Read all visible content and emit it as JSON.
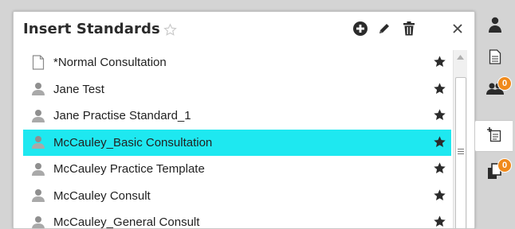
{
  "panel": {
    "title": "Insert Standards",
    "icons": {
      "favorite_title": "star-outline-icon",
      "add": "plus-circle-icon",
      "edit": "pencil-icon",
      "delete": "trash-icon",
      "close": "close-icon"
    }
  },
  "items": [
    {
      "label": "*Normal Consultation",
      "icon": "document-icon",
      "selected": false
    },
    {
      "label": "Jane Test",
      "icon": "user-icon",
      "selected": false
    },
    {
      "label": "Jane Practise Standard_1",
      "icon": "user-icon",
      "selected": false
    },
    {
      "label": "McCauley_Basic Consultation",
      "icon": "user-icon",
      "selected": true
    },
    {
      "label": "McCauley Practice Template",
      "icon": "user-icon",
      "selected": false
    },
    {
      "label": "McCauley Consult",
      "icon": "user-icon",
      "selected": false
    },
    {
      "label": "McCauley_General Consult",
      "icon": "user-icon",
      "selected": false
    }
  ],
  "sidebar": {
    "items": [
      {
        "icon": "person-icon",
        "badge": ""
      },
      {
        "icon": "document-lines-icon",
        "badge": ""
      },
      {
        "icon": "group-icon",
        "badge": "0"
      },
      {
        "icon": "insert-standard-icon",
        "badge": "",
        "active": true
      },
      {
        "icon": "copy-pages-icon",
        "badge": "0"
      }
    ]
  },
  "colors": {
    "selected_row": "#1ee8f0",
    "badge": "#f08a1c"
  }
}
